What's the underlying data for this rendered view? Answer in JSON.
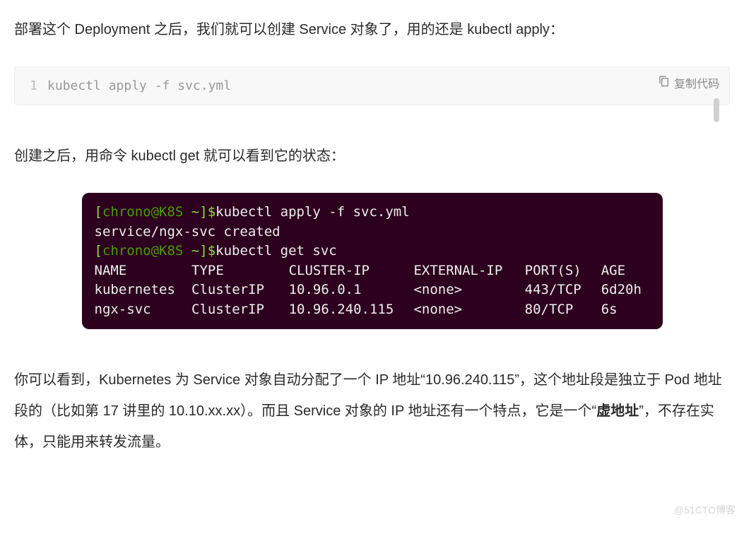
{
  "para1": "部署这个 Deployment 之后，我们就可以创建 Service 对象了，用的还是 kubectl apply：",
  "codebox": {
    "copy_label": "复制代码",
    "lineno": "1",
    "code": "kubectl apply -f svc.yml"
  },
  "para2": "创建之后，用命令 kubectl get 就可以看到它的状态：",
  "terminal": {
    "prompt_open": "[",
    "prompt_user": "chrono@K8S ",
    "prompt_tilde": "~",
    "prompt_close": "]$",
    "cmd1": "kubectl apply -f svc.yml",
    "out1": "service/ngx-svc created",
    "cmd2": "kubectl get svc",
    "headers": {
      "name": "NAME",
      "type": "TYPE",
      "cip": "CLUSTER-IP",
      "eip": "EXTERNAL-IP",
      "port": "PORT(S)",
      "age": "AGE"
    },
    "rows": [
      {
        "name": "kubernetes",
        "type": "ClusterIP",
        "cip": "10.96.0.1",
        "eip": "<none>",
        "port": "443/TCP",
        "age": "6d20h"
      },
      {
        "name": "ngx-svc",
        "type": "ClusterIP",
        "cip": "10.96.240.115",
        "eip": "<none>",
        "port": "80/TCP",
        "age": "6s"
      }
    ]
  },
  "para3_a": "你可以看到，Kubernetes 为 Service 对象自动分配了一个 IP 地址“10.96.240.115”，这个地址段是独立于 Pod 地址段的（比如第 17 讲里的 10.10.xx.xx）。而且 Service 对象的 IP 地址还有一个特点，它是一个“",
  "para3_bold": "虚地址",
  "para3_b": "”，不存在实体，只能用来转发流量。",
  "watermark": "@51CTO博客"
}
